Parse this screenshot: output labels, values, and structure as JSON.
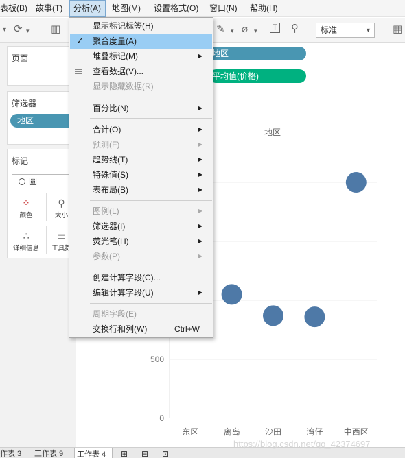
{
  "menubar": {
    "items": [
      "表板(B)",
      "故事(T)",
      "分析(A)",
      "地图(M)",
      "设置格式(O)",
      "窗口(N)",
      "帮助(H)"
    ]
  },
  "toolbar": {
    "fit_select": "标准"
  },
  "panes": {
    "pages_title": "页面",
    "filters_title": "筛选器",
    "filter_pill": "地区",
    "marks_title": "标记",
    "marks_type": "圆",
    "marks_buttons": [
      "颜色",
      "大小",
      "详细信息",
      "工具提"
    ]
  },
  "shelves": {
    "columns_pill": "地区",
    "rows_pill": "平均值(价格)"
  },
  "analysis_menu": {
    "items": [
      {
        "label": "显示标记标签(H)"
      },
      {
        "label": "聚合度量(A)",
        "checked": true
      },
      {
        "label": "堆叠标记(M)"
      },
      {
        "label": "查看数据(V)..."
      },
      {
        "label": "显示隐藏数据(R)"
      },
      {
        "label": "百分比(N)"
      },
      {
        "label": "合计(O)"
      },
      {
        "label": "预测(F)"
      },
      {
        "label": "趋势线(T)"
      },
      {
        "label": "特殊值(S)"
      },
      {
        "label": "表布局(B)"
      },
      {
        "label": "图例(L)"
      },
      {
        "label": "筛选器(I)"
      },
      {
        "label": "荧光笔(H)"
      },
      {
        "label": "参数(P)"
      },
      {
        "label": "创建计算字段(C)..."
      },
      {
        "label": "编辑计算字段(U)"
      },
      {
        "label": "周期字段(E)"
      },
      {
        "label": "交换行和列(W)",
        "shortcut": "Ctrl+W"
      }
    ]
  },
  "chart_data": {
    "type": "scatter",
    "title": "地区",
    "categories": [
      "东区",
      "离岛",
      "沙田",
      "湾仔",
      "中西区"
    ],
    "values": [
      null,
      1050,
      870,
      860,
      2000
    ],
    "y_tick_labels": [
      "0",
      "500"
    ],
    "ylim": [
      0,
      2200
    ],
    "mark_color": "#4e79a7",
    "grid": true
  },
  "tabs": [
    "作表 3",
    "工作表 9",
    "工作表 4"
  ],
  "watermark": "https://blog.csdn.net/qq_42374697"
}
